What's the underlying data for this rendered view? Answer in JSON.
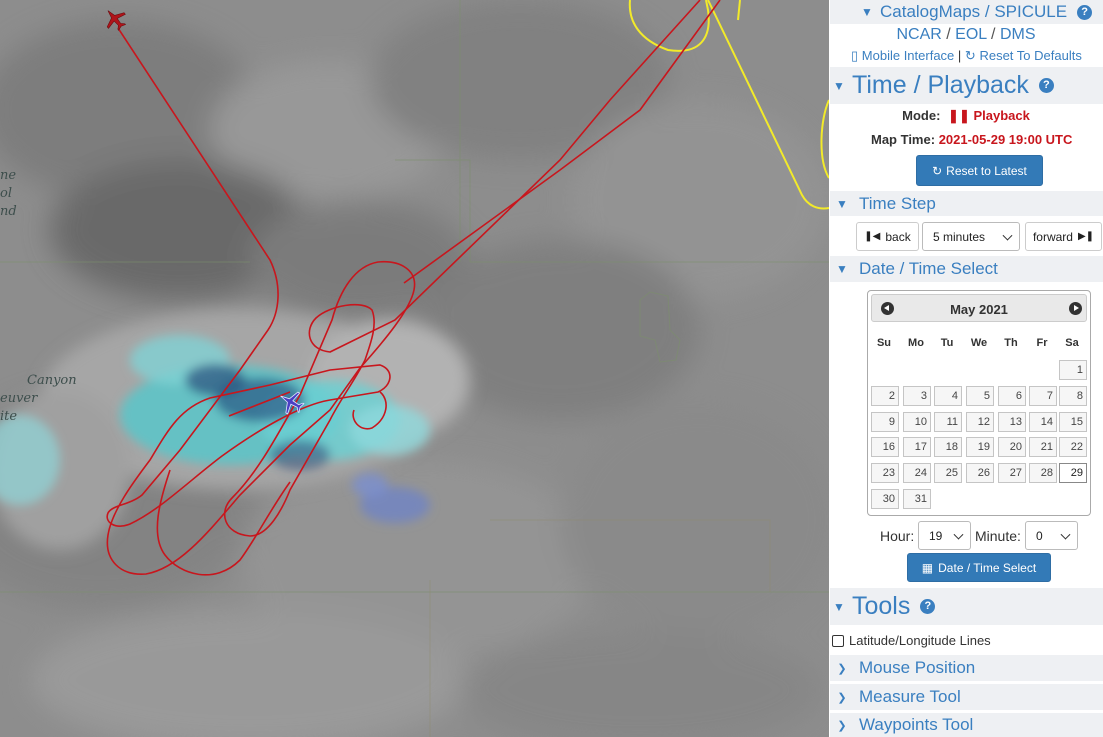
{
  "map": {
    "labels": [
      "ne",
      "ol",
      "nd",
      "Canyon",
      "euver",
      "ite"
    ]
  },
  "header": {
    "title": "CatalogMaps / SPICULE",
    "links": [
      "NCAR",
      "EOL",
      "DMS"
    ],
    "mobile_label": "Mobile Interface",
    "separator": "|",
    "reset_defaults_label": "Reset To Defaults"
  },
  "time_playback": {
    "title": "Time / Playback",
    "mode_label": "Mode:",
    "mode_value": "Playback",
    "map_time_label": "Map Time:",
    "map_time_value": "2021-05-29 19:00 UTC",
    "reset_button": "Reset to Latest"
  },
  "time_step": {
    "title": "Time Step",
    "back_label": "back",
    "step_value": "5 minutes",
    "forward_label": "forward"
  },
  "date_time_select": {
    "title": "Date / Time Select",
    "calendar": {
      "month_title": "May 2021",
      "weekdays": [
        "Su",
        "Mo",
        "Tu",
        "We",
        "Th",
        "Fr",
        "Sa"
      ],
      "days": [
        "1",
        "2",
        "3",
        "4",
        "5",
        "6",
        "7",
        "8",
        "9",
        "10",
        "11",
        "12",
        "13",
        "14",
        "15",
        "16",
        "17",
        "18",
        "19",
        "20",
        "21",
        "22",
        "23",
        "24",
        "25",
        "26",
        "27",
        "28",
        "29",
        "30",
        "31"
      ],
      "selected_day": "29"
    },
    "hour_label": "Hour:",
    "hour_value": "19",
    "minute_label": "Minute:",
    "minute_value": "0",
    "select_button": "Date / Time Select"
  },
  "tools": {
    "title": "Tools",
    "latlon_label": "Latitude/Longitude Lines",
    "sections": [
      "Mouse Position",
      "Measure Tool",
      "Waypoints Tool"
    ]
  },
  "colors": {
    "accent": "#3a7fc0",
    "track_red": "#c8161d",
    "track_yellow": "#f2ea2a",
    "playback_red": "#c8161d"
  },
  "icons": {
    "collapse": "chevron-down-icon",
    "expand": "chevron-right-icon",
    "help": "question-circle-icon",
    "mobile": "mobile-icon",
    "refresh": "refresh-icon",
    "pause": "pause-icon",
    "step_back": "step-backward-icon",
    "step_forward": "step-forward-icon",
    "calendar": "calendar-icon",
    "checkbox": "checkbox-icon",
    "aircraft": "airplane-icon"
  }
}
